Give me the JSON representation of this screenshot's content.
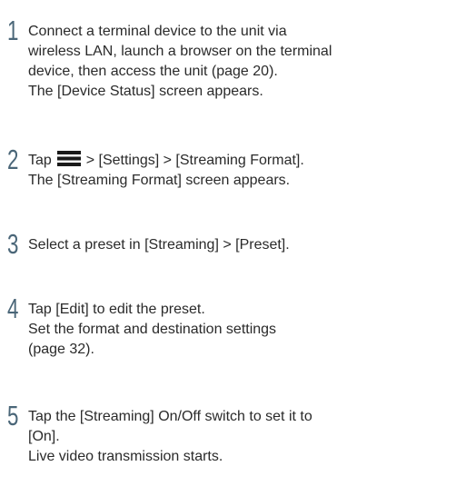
{
  "steps": [
    {
      "number": "1",
      "lines": [
        "Connect a terminal device to the unit via",
        "wireless LAN, launch a browser on the terminal",
        "device, then access the unit (page 20).",
        "The [Device Status] screen appears."
      ]
    },
    {
      "number": "2",
      "line1_before_icon": "Tap",
      "icon": "menu-icon",
      "line1_after_icon": "> [Settings] > [Streaming Format].",
      "lines_rest": [
        "The [Streaming Format] screen appears."
      ]
    },
    {
      "number": "3",
      "lines": [
        "Select a preset in [Streaming] > [Preset]."
      ]
    },
    {
      "number": "4",
      "lines": [
        "Tap [Edit] to edit the preset.",
        "Set the format and destination settings",
        "(page 32)."
      ]
    },
    {
      "number": "5",
      "lines": [
        "Tap the [Streaming] On/Off switch to set it to",
        "[On].",
        "Live video transmission starts."
      ]
    }
  ],
  "colors": {
    "number": "#4a6678",
    "text": "#2a2a2a",
    "icon": "#1a1a1a"
  }
}
